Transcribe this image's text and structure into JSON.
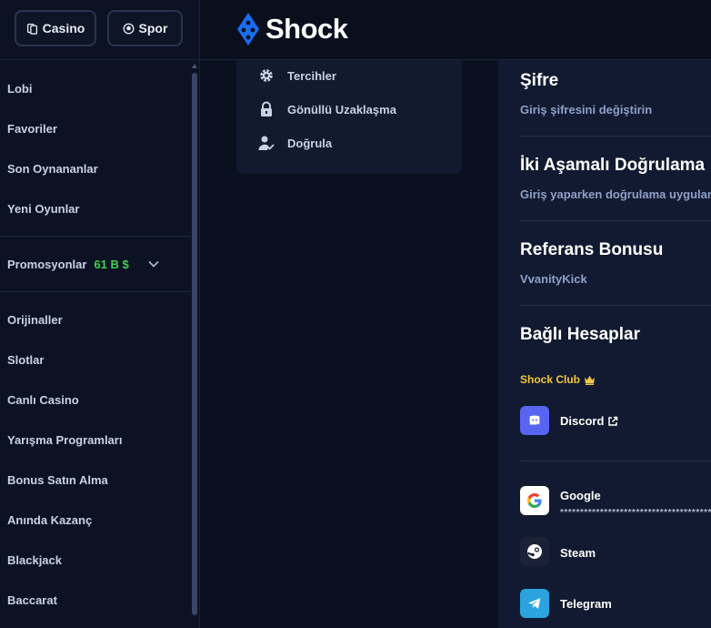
{
  "top_nav": {
    "casino_label": "Casino",
    "spor_label": "Spor"
  },
  "brand": {
    "name": "Shock",
    "accent": "#1a6cf0"
  },
  "sidebar": {
    "items_top": [
      "Lobi",
      "Favoriler",
      "Son Oynananlar",
      "Yeni Oyunlar"
    ],
    "promo": {
      "label": "Promosyonlar",
      "amount": "61 B $"
    },
    "items_bottom": [
      "Orijinaller",
      "Slotlar",
      "Canlı Casino",
      "Yarışma Programları",
      "Bonus Satın Alma",
      "Anında Kazanç",
      "Blackjack",
      "Baccarat"
    ]
  },
  "settings_menu": {
    "items": [
      {
        "label": "Tercihler",
        "icon": "gear-icon"
      },
      {
        "label": "Gönüllü Uzaklaşma",
        "icon": "lock-icon"
      },
      {
        "label": "Doğrula",
        "icon": "user-check-icon"
      }
    ]
  },
  "panel": {
    "password": {
      "title": "Şifre",
      "subtitle": "Giriş şifresini değiştirin"
    },
    "two_factor": {
      "title": "İki Aşamalı Doğrulama",
      "subtitle": "Giriş yaparken doğrulama uygulaması kullanın"
    },
    "referral": {
      "title": "Referans Bonusu",
      "code": "VvanityKick"
    },
    "linked": {
      "title": "Bağlı Hesaplar",
      "club_label": "Shock Club",
      "accounts": [
        {
          "name": "Discord",
          "icon": "discord-icon"
        },
        {
          "name": "Google",
          "icon": "google-icon",
          "masked": "**************************************"
        },
        {
          "name": "Steam",
          "icon": "steam-icon"
        },
        {
          "name": "Telegram",
          "icon": "telegram-icon"
        }
      ]
    }
  },
  "colors": {
    "promo_green": "#3fd14f",
    "club_gold": "#f2c641",
    "discord": "#5865f2",
    "telegram": "#2aa3df"
  }
}
